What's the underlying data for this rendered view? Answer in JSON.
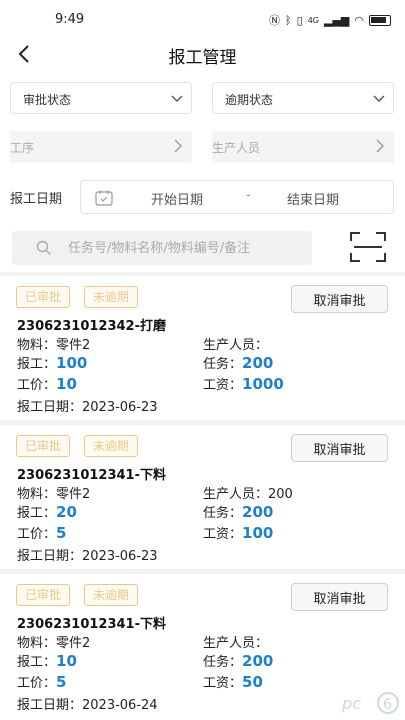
{
  "status_bar": {
    "time": "9:49",
    "icons": [
      "nfc-icon",
      "bluetooth-icon",
      "vibrate-icon",
      "signal-icon",
      "wifi-icon",
      "battery-icon"
    ],
    "network": "4G"
  },
  "nav": {
    "title": "报工管理"
  },
  "filters": {
    "approval_status": "审批状态",
    "overdue_status": "逾期状态",
    "process": "工序",
    "producer": "生产人员",
    "date_label": "报工日期",
    "start_date": "开始日期",
    "separator": "-",
    "end_date": "结束日期",
    "search_placeholder": "任务号/物料名称/物料编号/备注"
  },
  "labels": {
    "material": "物料：",
    "producer": "生产人员：",
    "reported": "报工：",
    "task": "任务：",
    "unit_price": "工价：",
    "wage": "工资：",
    "report_date": "报工日期：",
    "cancel": "取消审批"
  },
  "records": [
    {
      "status": "已审批",
      "overdue": "未逾期",
      "title": "2306231012342-打磨",
      "material": "零件2",
      "producer": "",
      "reported": "100",
      "task": "200",
      "unit_price": "10",
      "wage": "1000",
      "date": "2023-06-23"
    },
    {
      "status": "已审批",
      "overdue": "未逾期",
      "title": "2306231012341-下料",
      "material": "零件2",
      "producer": "200",
      "reported": "20",
      "task": "200",
      "unit_price": "5",
      "wage": "100",
      "date": "2023-06-23"
    },
    {
      "status": "已审批",
      "overdue": "未逾期",
      "title": "2306231012341-下料",
      "material": "零件2",
      "producer": "",
      "reported": "10",
      "task": "200",
      "unit_price": "5",
      "wage": "50",
      "date": "2023-06-24"
    }
  ],
  "watermark": "pc6"
}
